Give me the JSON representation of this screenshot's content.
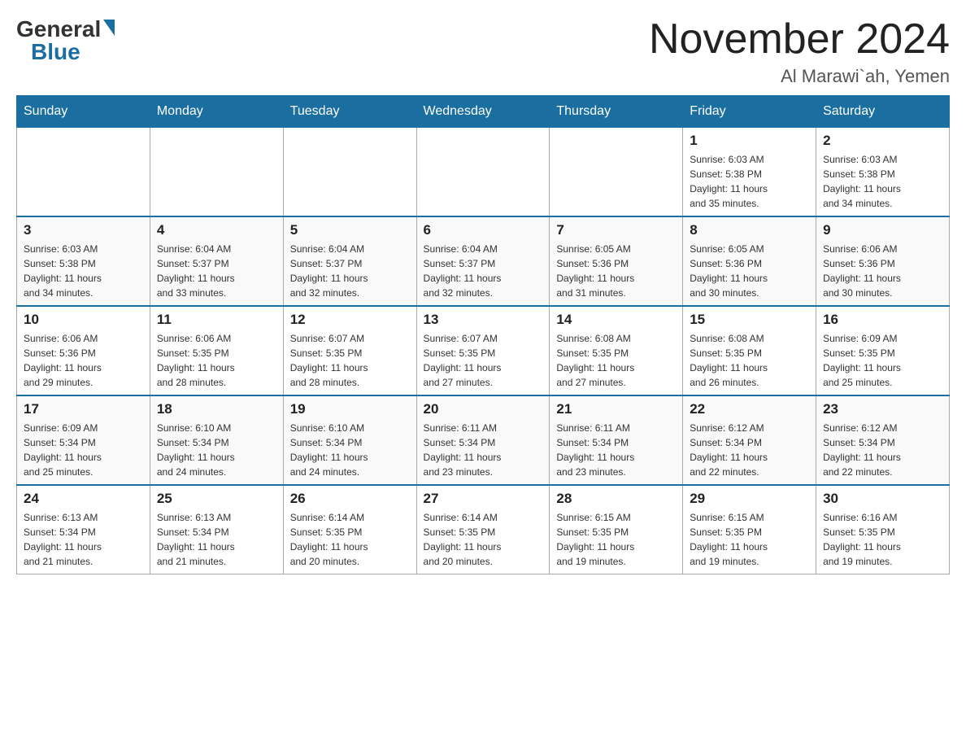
{
  "header": {
    "logo_general": "General",
    "logo_blue": "Blue",
    "month_title": "November 2024",
    "location": "Al Marawi`ah, Yemen"
  },
  "days_of_week": [
    "Sunday",
    "Monday",
    "Tuesday",
    "Wednesday",
    "Thursday",
    "Friday",
    "Saturday"
  ],
  "weeks": [
    [
      {
        "day": "",
        "info": ""
      },
      {
        "day": "",
        "info": ""
      },
      {
        "day": "",
        "info": ""
      },
      {
        "day": "",
        "info": ""
      },
      {
        "day": "",
        "info": ""
      },
      {
        "day": "1",
        "info": "Sunrise: 6:03 AM\nSunset: 5:38 PM\nDaylight: 11 hours\nand 35 minutes."
      },
      {
        "day": "2",
        "info": "Sunrise: 6:03 AM\nSunset: 5:38 PM\nDaylight: 11 hours\nand 34 minutes."
      }
    ],
    [
      {
        "day": "3",
        "info": "Sunrise: 6:03 AM\nSunset: 5:38 PM\nDaylight: 11 hours\nand 34 minutes."
      },
      {
        "day": "4",
        "info": "Sunrise: 6:04 AM\nSunset: 5:37 PM\nDaylight: 11 hours\nand 33 minutes."
      },
      {
        "day": "5",
        "info": "Sunrise: 6:04 AM\nSunset: 5:37 PM\nDaylight: 11 hours\nand 32 minutes."
      },
      {
        "day": "6",
        "info": "Sunrise: 6:04 AM\nSunset: 5:37 PM\nDaylight: 11 hours\nand 32 minutes."
      },
      {
        "day": "7",
        "info": "Sunrise: 6:05 AM\nSunset: 5:36 PM\nDaylight: 11 hours\nand 31 minutes."
      },
      {
        "day": "8",
        "info": "Sunrise: 6:05 AM\nSunset: 5:36 PM\nDaylight: 11 hours\nand 30 minutes."
      },
      {
        "day": "9",
        "info": "Sunrise: 6:06 AM\nSunset: 5:36 PM\nDaylight: 11 hours\nand 30 minutes."
      }
    ],
    [
      {
        "day": "10",
        "info": "Sunrise: 6:06 AM\nSunset: 5:36 PM\nDaylight: 11 hours\nand 29 minutes."
      },
      {
        "day": "11",
        "info": "Sunrise: 6:06 AM\nSunset: 5:35 PM\nDaylight: 11 hours\nand 28 minutes."
      },
      {
        "day": "12",
        "info": "Sunrise: 6:07 AM\nSunset: 5:35 PM\nDaylight: 11 hours\nand 28 minutes."
      },
      {
        "day": "13",
        "info": "Sunrise: 6:07 AM\nSunset: 5:35 PM\nDaylight: 11 hours\nand 27 minutes."
      },
      {
        "day": "14",
        "info": "Sunrise: 6:08 AM\nSunset: 5:35 PM\nDaylight: 11 hours\nand 27 minutes."
      },
      {
        "day": "15",
        "info": "Sunrise: 6:08 AM\nSunset: 5:35 PM\nDaylight: 11 hours\nand 26 minutes."
      },
      {
        "day": "16",
        "info": "Sunrise: 6:09 AM\nSunset: 5:35 PM\nDaylight: 11 hours\nand 25 minutes."
      }
    ],
    [
      {
        "day": "17",
        "info": "Sunrise: 6:09 AM\nSunset: 5:34 PM\nDaylight: 11 hours\nand 25 minutes."
      },
      {
        "day": "18",
        "info": "Sunrise: 6:10 AM\nSunset: 5:34 PM\nDaylight: 11 hours\nand 24 minutes."
      },
      {
        "day": "19",
        "info": "Sunrise: 6:10 AM\nSunset: 5:34 PM\nDaylight: 11 hours\nand 24 minutes."
      },
      {
        "day": "20",
        "info": "Sunrise: 6:11 AM\nSunset: 5:34 PM\nDaylight: 11 hours\nand 23 minutes."
      },
      {
        "day": "21",
        "info": "Sunrise: 6:11 AM\nSunset: 5:34 PM\nDaylight: 11 hours\nand 23 minutes."
      },
      {
        "day": "22",
        "info": "Sunrise: 6:12 AM\nSunset: 5:34 PM\nDaylight: 11 hours\nand 22 minutes."
      },
      {
        "day": "23",
        "info": "Sunrise: 6:12 AM\nSunset: 5:34 PM\nDaylight: 11 hours\nand 22 minutes."
      }
    ],
    [
      {
        "day": "24",
        "info": "Sunrise: 6:13 AM\nSunset: 5:34 PM\nDaylight: 11 hours\nand 21 minutes."
      },
      {
        "day": "25",
        "info": "Sunrise: 6:13 AM\nSunset: 5:34 PM\nDaylight: 11 hours\nand 21 minutes."
      },
      {
        "day": "26",
        "info": "Sunrise: 6:14 AM\nSunset: 5:35 PM\nDaylight: 11 hours\nand 20 minutes."
      },
      {
        "day": "27",
        "info": "Sunrise: 6:14 AM\nSunset: 5:35 PM\nDaylight: 11 hours\nand 20 minutes."
      },
      {
        "day": "28",
        "info": "Sunrise: 6:15 AM\nSunset: 5:35 PM\nDaylight: 11 hours\nand 19 minutes."
      },
      {
        "day": "29",
        "info": "Sunrise: 6:15 AM\nSunset: 5:35 PM\nDaylight: 11 hours\nand 19 minutes."
      },
      {
        "day": "30",
        "info": "Sunrise: 6:16 AM\nSunset: 5:35 PM\nDaylight: 11 hours\nand 19 minutes."
      }
    ]
  ]
}
